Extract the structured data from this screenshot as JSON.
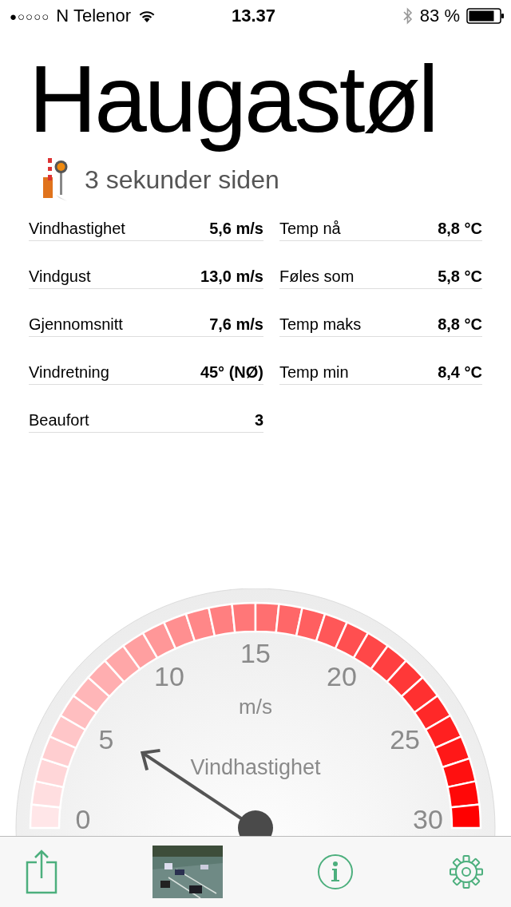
{
  "status_bar": {
    "signal_dots": "●○○○○",
    "carrier": "N Telenor",
    "time": "13.37",
    "battery_percent": "83 %"
  },
  "station": {
    "name": "Haugastøl",
    "updated": "3 sekunder siden"
  },
  "wind_readings": [
    {
      "label": "Vindhastighet",
      "value": "5,6 m/s"
    },
    {
      "label": "Vindgust",
      "value": "13,0 m/s"
    },
    {
      "label": "Gjennomsnitt",
      "value": "7,6 m/s"
    },
    {
      "label": "Vindretning",
      "value": "45° (NØ)"
    },
    {
      "label": "Beaufort",
      "value": "3"
    }
  ],
  "temperature_readings": [
    {
      "label": "Temp nå",
      "value": "8,8 °C"
    },
    {
      "label": "Føles som",
      "value": "5,8 °C"
    },
    {
      "label": "Temp maks",
      "value": "8,8 °C"
    },
    {
      "label": "Temp min",
      "value": "8,4 °C"
    }
  ],
  "gauge": {
    "scale_labels": [
      "0",
      "5",
      "10",
      "15",
      "20",
      "25",
      "30"
    ],
    "unit": "m/s",
    "title": "Vindhastighet"
  },
  "toolbar": [
    {
      "kind": "share"
    },
    {
      "kind": "picture"
    },
    {
      "kind": "info"
    },
    {
      "kind": "settings"
    }
  ]
}
